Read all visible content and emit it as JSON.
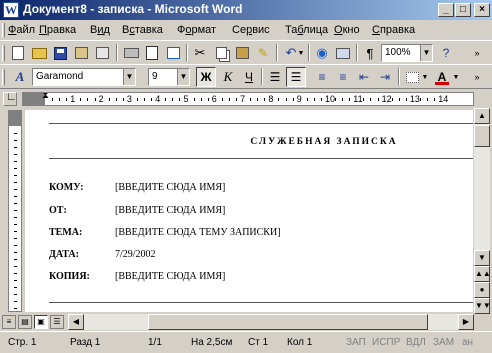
{
  "window": {
    "title": "Документ8 - записка - Microsoft Word",
    "app_icon_glyph": "W",
    "minimize_glyph": "_",
    "maximize_glyph": "□",
    "close_glyph": "×"
  },
  "menu": {
    "items": [
      "Файл",
      "Правка",
      "Вид",
      "Вставка",
      "Формат",
      "Сервис",
      "Таблица",
      "Окно",
      "Справка"
    ],
    "hotkeys": [
      "Ф",
      "П",
      "и",
      "с",
      "о",
      "р",
      "б",
      "О",
      "С"
    ]
  },
  "standard_toolbar": {
    "zoom": "100%",
    "paragraph_glyph": "¶"
  },
  "formatting_toolbar": {
    "style_name": "Garamond",
    "font_size": "9",
    "bold_glyph": "Ж",
    "italic_glyph": "К",
    "underline_glyph": "Ч",
    "font_color": "#d40000",
    "highlight_color": "#ffff00",
    "style_prefix": "A"
  },
  "ruler": {
    "numbers": [
      "1",
      "2",
      "3",
      "4",
      "5",
      "6",
      "7",
      "8",
      "9",
      "10",
      "11",
      "12",
      "13",
      "14"
    ]
  },
  "document": {
    "heading": "СЛУЖЕБНАЯ ЗАПИСКА",
    "fields": [
      {
        "label": "КОМУ:",
        "value": "[ВВЕДИТЕ СЮДА ИМЯ]"
      },
      {
        "label": "ОТ:",
        "value": "[ВВЕДИТЕ СЮДА ИМЯ]"
      },
      {
        "label": "ТЕМА:",
        "value": "[ВВЕДИТЕ СЮДА ТЕМУ ЗАПИСКИ]"
      },
      {
        "label": "ДАТА:",
        "value": "7/29/2002"
      },
      {
        "label": "КОПИЯ:",
        "value": "[ВВЕДИТЕ СЮДА ИМЯ]"
      }
    ]
  },
  "statusbar": {
    "page": "Стр. 1",
    "section": "Разд 1",
    "pages": "1/1",
    "position": "На 2,5см",
    "line": "Ст 1",
    "column": "Кол 1",
    "rec": "ЗАП",
    "track": "ИСПР",
    "ext": "ВДЛ",
    "ovr": "ЗАМ",
    "lang": "ан"
  }
}
